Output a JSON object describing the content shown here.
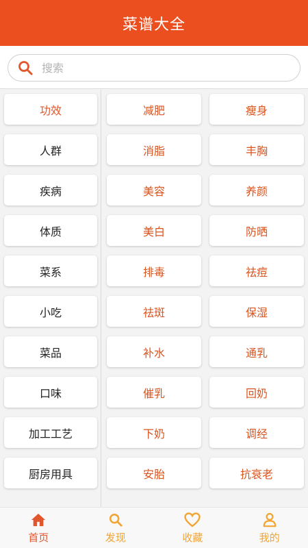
{
  "header": {
    "title": "菜谱大全"
  },
  "search": {
    "placeholder": "搜索",
    "value": ""
  },
  "categories": [
    {
      "label": "功效",
      "active": true
    },
    {
      "label": "人群",
      "active": false
    },
    {
      "label": "疾病",
      "active": false
    },
    {
      "label": "体质",
      "active": false
    },
    {
      "label": "菜系",
      "active": false
    },
    {
      "label": "小吃",
      "active": false
    },
    {
      "label": "菜品",
      "active": false
    },
    {
      "label": "口味",
      "active": false
    },
    {
      "label": "加工工艺",
      "active": false
    },
    {
      "label": "厨房用具",
      "active": false
    }
  ],
  "subcategories": [
    [
      "减肥",
      "瘦身"
    ],
    [
      "消脂",
      "丰胸"
    ],
    [
      "美容",
      "养颜"
    ],
    [
      "美白",
      "防晒"
    ],
    [
      "排毒",
      "祛痘"
    ],
    [
      "祛斑",
      "保湿"
    ],
    [
      "补水",
      "通乳"
    ],
    [
      "催乳",
      "回奶"
    ],
    [
      "下奶",
      "调经"
    ],
    [
      "安胎",
      "抗衰老"
    ]
  ],
  "tabbar": {
    "items": [
      {
        "label": "首页",
        "icon": "home-icon",
        "active": true
      },
      {
        "label": "发现",
        "icon": "search-icon",
        "active": false
      },
      {
        "label": "收藏",
        "icon": "heart-icon",
        "active": false
      },
      {
        "label": "我的",
        "icon": "user-icon",
        "active": false
      }
    ]
  },
  "colors": {
    "brand": "#ec4f1f",
    "accent_text": "#e2562b",
    "tab_inactive": "#f2a533"
  }
}
